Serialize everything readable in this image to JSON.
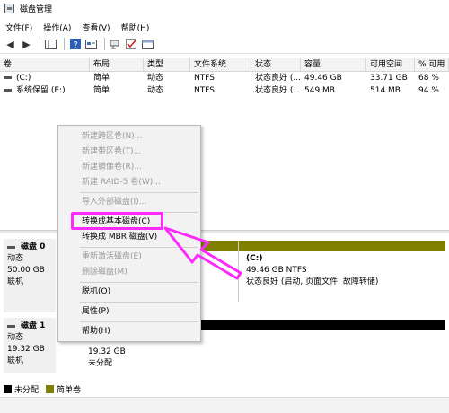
{
  "window": {
    "title": "磁盘管理"
  },
  "menubar": [
    "文件(F)",
    "操作(A)",
    "查看(V)",
    "帮助(H)"
  ],
  "toolbar_icons": [
    "back-arrow",
    "forward-arrow",
    "console-tree",
    "help",
    "properties",
    "connect",
    "check",
    "window"
  ],
  "volume_table": {
    "headers": [
      "卷",
      "布局",
      "类型",
      "文件系统",
      "状态",
      "容量",
      "可用空间",
      "% 可用"
    ],
    "rows": [
      [
        "(C:)",
        "简单",
        "动态",
        "NTFS",
        "状态良好 (...",
        "49.46 GB",
        "33.71 GB",
        "68 %"
      ],
      [
        "系统保留 (E:)",
        "简单",
        "动态",
        "NTFS",
        "状态良好 (...",
        "549 MB",
        "514 MB",
        "94 %"
      ]
    ]
  },
  "disks": [
    {
      "name": "磁盘 0",
      "type": "动态",
      "size": "50.00 GB",
      "status": "联机"
    },
    {
      "name": "磁盘 1",
      "type": "动态",
      "size": "19.32 GB",
      "status": "联机"
    }
  ],
  "partition_c": {
    "name": "(C:)",
    "size_fs": "49.46 GB NTFS",
    "status": "状态良好 (启动, 页面文件, 故障转储)"
  },
  "unallocated": {
    "size": "19.32 GB",
    "label": "未分配"
  },
  "legend": [
    "未分配",
    "简单卷"
  ],
  "legend_colors": {
    "unallocated": "#000000",
    "simple": "#808000"
  },
  "context_menu": [
    {
      "label": "新建跨区卷(N)...",
      "enabled": false
    },
    {
      "label": "新建带区卷(T)...",
      "enabled": false
    },
    {
      "label": "新建镜像卷(R)...",
      "enabled": false
    },
    {
      "label": "新建 RAID-5 卷(W)...",
      "enabled": false
    },
    {
      "separator": true
    },
    {
      "label": "导入外部磁盘(I)...",
      "enabled": false
    },
    {
      "separator": true
    },
    {
      "label": "转换成基本磁盘(C)",
      "enabled": true
    },
    {
      "label": "转换成 MBR 磁盘(V)",
      "enabled": true
    },
    {
      "separator": true
    },
    {
      "label": "重新激活磁盘(E)",
      "enabled": false
    },
    {
      "label": "删除磁盘(M)",
      "enabled": false
    },
    {
      "separator": true
    },
    {
      "label": "脱机(O)",
      "enabled": true
    },
    {
      "separator": true
    },
    {
      "label": "属性(P)",
      "enabled": true
    },
    {
      "separator": true
    },
    {
      "label": "帮助(H)",
      "enabled": true
    }
  ],
  "annotation_color": "#ff2aff"
}
